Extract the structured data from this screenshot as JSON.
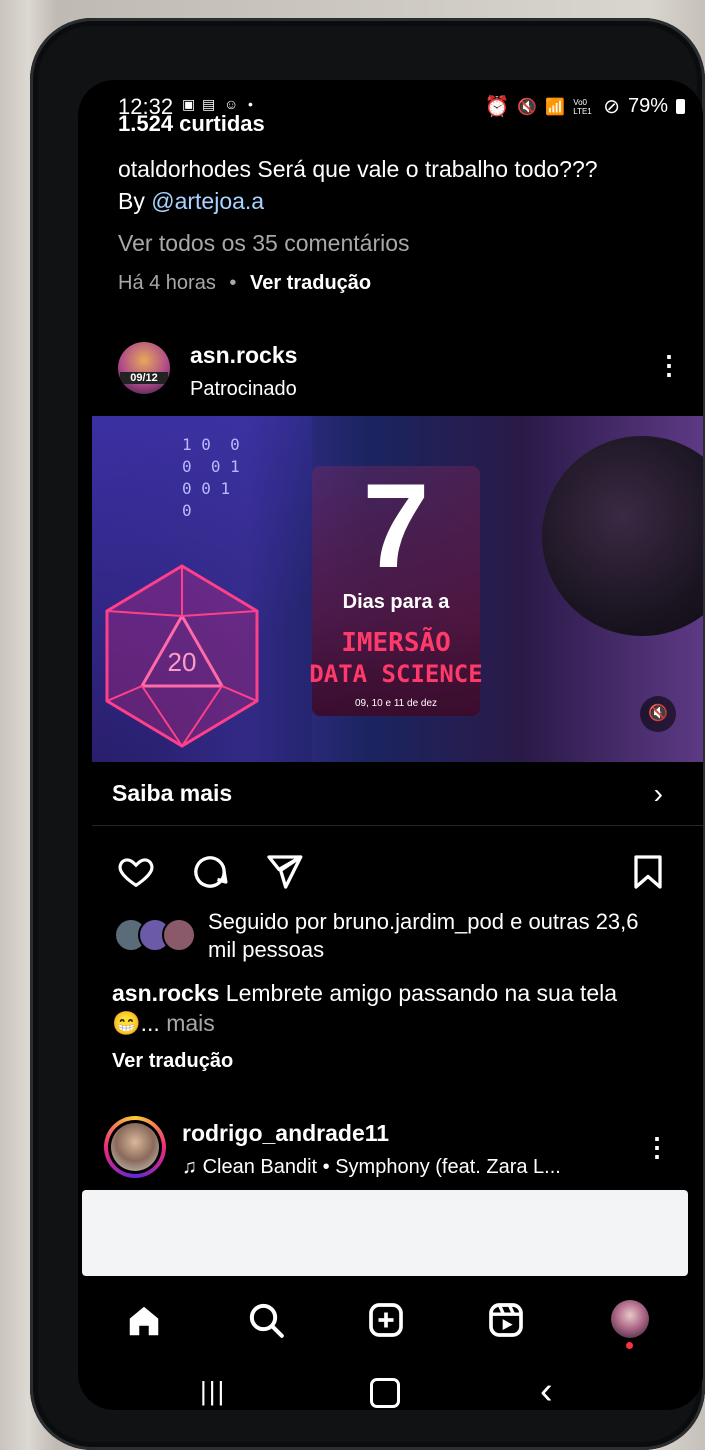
{
  "status_bar": {
    "time": "12:32",
    "left_icons": [
      "calendar-icon",
      "calendar-31-icon",
      "smiley-icon",
      "dot"
    ],
    "right_icons": [
      "alarm-icon",
      "mute-icon",
      "wifi-icon",
      "volte-icon",
      "signal-icon",
      "dnd-icon"
    ],
    "volte": "Vo0 LTE1",
    "battery": "79%"
  },
  "prev_post": {
    "likes": "1.524 curtidas",
    "username": "otaldorhodes",
    "caption": "Será que vale o trabalho todo???",
    "by": "By",
    "mention": "@artejoa.a",
    "view_comments": "Ver todos os 35 comentários",
    "time": "Há 4 horas",
    "separator": "•",
    "translate": "Ver tradução"
  },
  "ad_post": {
    "username": "asn.rocks",
    "sponsored": "Patrocinado",
    "avatar_badge": "09/12",
    "image": {
      "big_number": "7",
      "line1": "Dias para a",
      "line2": "IMERSÃO",
      "line3": "DATA SCIENCE",
      "dates": "09, 10 e 11 de dez",
      "dice_number": "20",
      "binary": [
        "1 0  0",
        "0  0 1",
        "0 0 1",
        "0"
      ]
    },
    "cta": "Saiba mais",
    "followed_by": "Seguido por bruno.jardim_pod e outras 23,6 mil pessoas",
    "caption_username": "asn.rocks",
    "caption": "Lembrete amigo passando na sua tela",
    "emoji": "😁",
    "ellipsis": "...",
    "more": "mais",
    "translate": "Ver tradução"
  },
  "next_post": {
    "username": "rodrigo_andrade11",
    "music_icon": "music-note-icon",
    "music": "Clean Bandit • Symphony (feat. Zara L..."
  },
  "bottom_nav": [
    "home-icon",
    "search-icon",
    "new-post-icon",
    "reels-icon",
    "profile-avatar"
  ],
  "system_nav": [
    "recent-apps-icon",
    "home-button-icon",
    "back-icon"
  ]
}
